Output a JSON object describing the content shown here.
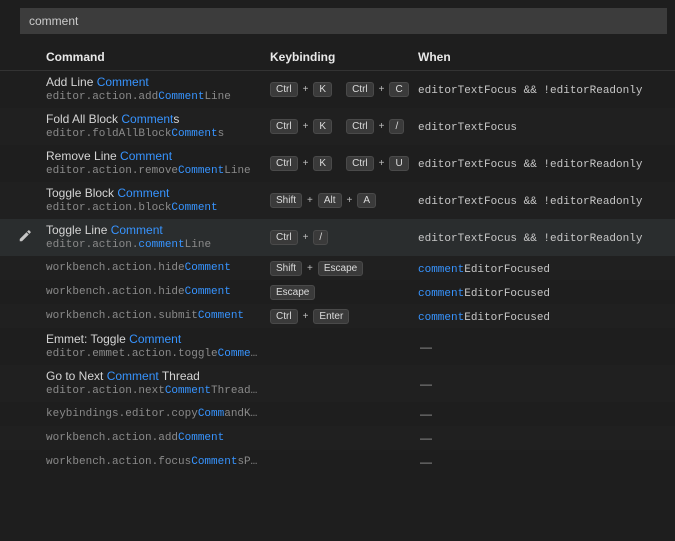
{
  "search": {
    "value": "comment"
  },
  "headers": {
    "command": "Command",
    "keybinding": "Keybinding",
    "when": "When"
  },
  "highlight_token": "Comment",
  "highlight_token_lower": "comment",
  "commands": [
    {
      "title": "Add Line Comment",
      "id": "editor.action.addCommentLine",
      "keys": [
        [
          "Ctrl",
          "K"
        ],
        [
          "Ctrl",
          "C"
        ]
      ],
      "when": "editorTextFocus && !editorReadonly",
      "selected": false
    },
    {
      "title": "Fold All Block Comments",
      "id": "editor.foldAllBlockComments",
      "keys": [
        [
          "Ctrl",
          "K"
        ],
        [
          "Ctrl",
          "/"
        ]
      ],
      "when": "editorTextFocus",
      "selected": false
    },
    {
      "title": "Remove Line Comment",
      "id": "editor.action.removeCommentLine",
      "keys": [
        [
          "Ctrl",
          "K"
        ],
        [
          "Ctrl",
          "U"
        ]
      ],
      "when": "editorTextFocus && !editorReadonly",
      "selected": false
    },
    {
      "title": "Toggle Block Comment",
      "id": "editor.action.blockComment",
      "keys": [
        [
          "Shift",
          "Alt",
          "A"
        ]
      ],
      "when": "editorTextFocus && !editorReadonly",
      "selected": false
    },
    {
      "title": "Toggle Line Comment",
      "id": "editor.action.commentLine",
      "keys": [
        [
          "Ctrl",
          "/"
        ]
      ],
      "when": "editorTextFocus && !editorReadonly",
      "selected": true
    },
    {
      "title": "",
      "id": "workbench.action.hideComment",
      "keys": [
        [
          "Shift",
          "Escape"
        ]
      ],
      "when": "commentEditorFocused",
      "selected": false
    },
    {
      "title": "",
      "id": "workbench.action.hideComment",
      "keys": [
        [
          "Escape"
        ]
      ],
      "when": "commentEditorFocused",
      "selected": false
    },
    {
      "title": "",
      "id": "workbench.action.submitComment",
      "keys": [
        [
          "Ctrl",
          "Enter"
        ]
      ],
      "when": "commentEditorFocused",
      "selected": false
    },
    {
      "title": "Emmet: Toggle Comment",
      "id": "editor.emmet.action.toggleComment",
      "keys": [],
      "when": "",
      "selected": false
    },
    {
      "title": "Go to Next Comment Thread",
      "id": "editor.action.nextCommentThreadActi",
      "keys": [],
      "when": "",
      "selected": false
    },
    {
      "title": "",
      "id": "keybindings.editor.copyCommandKey…",
      "keys": [],
      "when": "",
      "selected": false
    },
    {
      "title": "",
      "id": "workbench.action.addComment",
      "keys": [],
      "when": "",
      "selected": false
    },
    {
      "title": "",
      "id": "workbench.action.focusCommentsPan…",
      "keys": [],
      "when": "",
      "selected": false
    }
  ]
}
